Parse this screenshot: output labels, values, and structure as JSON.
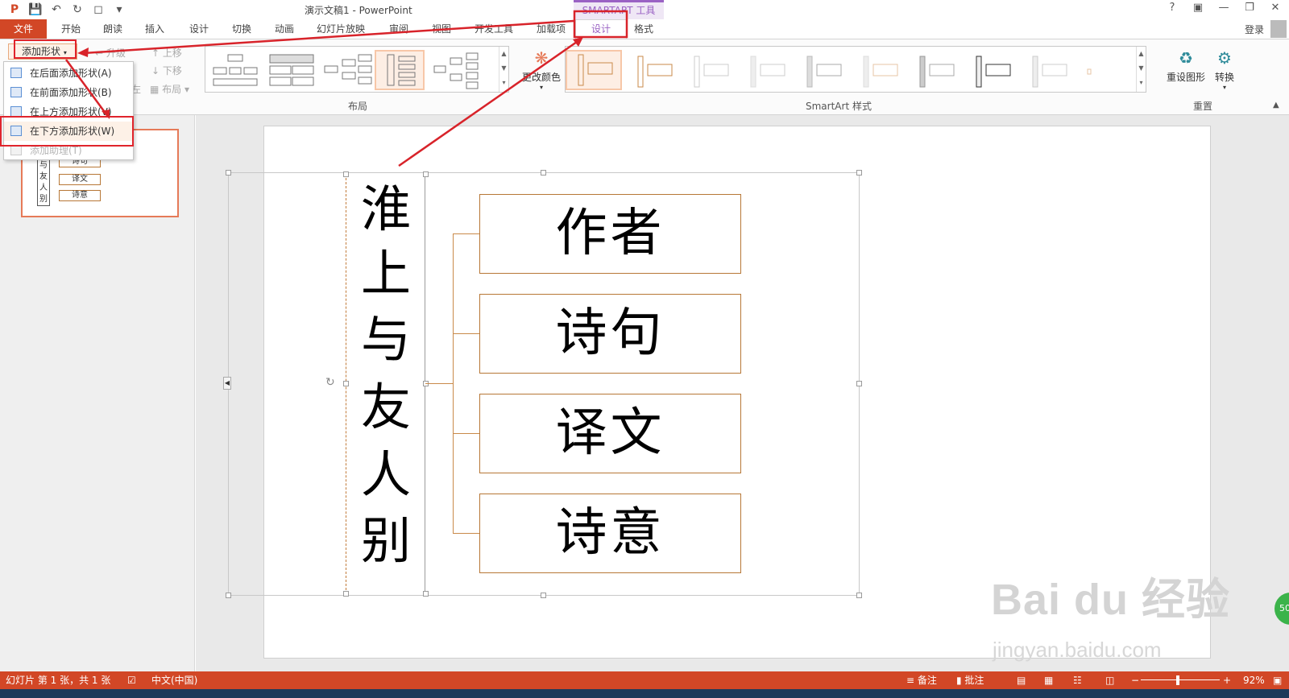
{
  "window": {
    "title": "演示文稿1 - PowerPoint",
    "context_header": "SMARTART 工具",
    "login": "登录"
  },
  "tabs": [
    "文件",
    "开始",
    "朗读",
    "插入",
    "设计",
    "切换",
    "动画",
    "幻灯片放映",
    "审阅",
    "视图",
    "开发工具",
    "加载项",
    "设计",
    "格式"
  ],
  "ribbon": {
    "add_shape": "添加形状",
    "promote": "升级",
    "move_up": "上移",
    "move_down": "下移",
    "layout_btn": "布局",
    "right_to_left": "左",
    "change_colors": "更改颜色",
    "reset_graphic": "重设图形",
    "convert": "转换",
    "group_layouts": "布局",
    "group_styles": "SmartArt 样式",
    "group_reset": "重置"
  },
  "dropdown": {
    "items": [
      "在后面添加形状(A)",
      "在前面添加形状(B)",
      "在上方添加形状(V)",
      "在下方添加形状(W)",
      "添加助理(T)"
    ]
  },
  "thumbnail": {
    "root_chars": [
      "与",
      "友",
      "人",
      "别"
    ],
    "children": [
      "诗句",
      "译文",
      "诗意"
    ],
    "partial_child": "诗句"
  },
  "smartart": {
    "root_chars": [
      "淮",
      "上",
      "与",
      "友",
      "人",
      "别"
    ],
    "children": [
      "作者",
      "诗句",
      "译文",
      "诗意"
    ]
  },
  "statusbar": {
    "slide_info": "幻灯片 第 1 张，共 1 张",
    "language": "中文(中国)",
    "notes": "备注",
    "comments": "批注",
    "zoom": "92%"
  },
  "watermark": {
    "logo_text": "Bai du 经验",
    "url": "jingyan.baidu.com",
    "badge": "50"
  },
  "colors": {
    "accent_orange": "#d24726",
    "context_purple": "#9a62c4",
    "annotation_red": "#d8232a",
    "box_border": "#b77736"
  }
}
